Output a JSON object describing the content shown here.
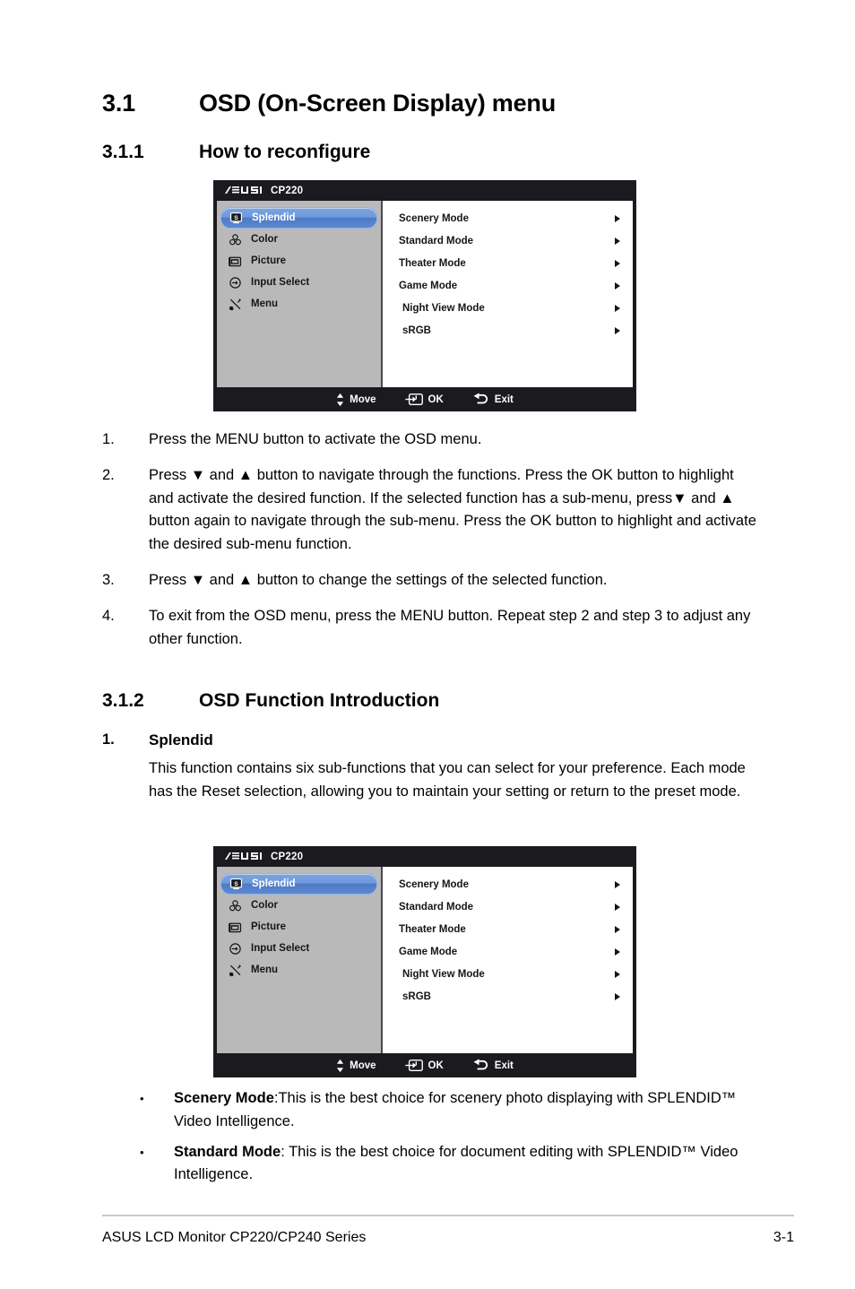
{
  "document": {
    "section_3_1": {
      "number": "3.1",
      "title": "OSD (On-Screen Display) menu"
    },
    "section_3_1_1": {
      "number": "3.1.1",
      "title": "How to reconfigure"
    },
    "section_3_1_2": {
      "number": "3.1.2",
      "title": "OSD Function Introduction"
    }
  },
  "steps": [
    {
      "marker": "1.",
      "text": "Press the MENU button to activate the OSD menu."
    },
    {
      "marker": "2.",
      "text": "Press ▼ and ▲ button to navigate through the functions. Press the OK button to highlight and activate the desired function. If the selected function has a sub-menu, press▼ and ▲ button again to navigate through the sub-menu. Press the OK button to highlight and activate the desired sub-menu function."
    },
    {
      "marker": "3.",
      "text": "Press ▼ and ▲ button to change the settings of the selected function."
    },
    {
      "marker": "4.",
      "text": "To exit from the OSD menu, press the MENU button. Repeat step 2 and step 3 to adjust any other function."
    }
  ],
  "splendid": {
    "marker": "1.",
    "title": "Splendid",
    "paragraph": "This function contains six sub-functions that you can select for your preference. Each mode has the Reset selection, allowing you to maintain your setting or return to the preset mode."
  },
  "bullets": [
    {
      "marker": "•",
      "term": "Scenery Mode",
      "separator": ":",
      "text": "This is the best choice for scenery photo displaying with SPLENDID™ Video Intelligence."
    },
    {
      "marker": "•",
      "term": "Standard Mode",
      "separator": ": ",
      "text": "This is the best choice for document editing with SPLENDID™ Video Intelligence."
    }
  ],
  "osd": {
    "brand": "ASUS",
    "model": "CP220",
    "sidebar": [
      {
        "label": "Splendid",
        "icon": "splendid-monitor-icon",
        "selected": true
      },
      {
        "label": "Color",
        "icon": "color-circles-icon",
        "selected": false
      },
      {
        "label": "Picture",
        "icon": "picture-frame-icon",
        "selected": false
      },
      {
        "label": "Input Select",
        "icon": "input-arrow-icon",
        "selected": false
      },
      {
        "label": "Menu",
        "icon": "tools-icon",
        "selected": false
      }
    ],
    "options": [
      {
        "label": "Scenery Mode",
        "indent": false,
        "arrow": "chevron-right-icon"
      },
      {
        "label": "Standard Mode",
        "indent": false,
        "arrow": "chevron-right-icon"
      },
      {
        "label": "Theater Mode",
        "indent": false,
        "arrow": "chevron-right-icon"
      },
      {
        "label": "Game Mode",
        "indent": false,
        "arrow": "chevron-right-icon"
      },
      {
        "label": "Night View Mode",
        "indent": true,
        "arrow": "chevron-right-icon"
      },
      {
        "label": "sRGB",
        "indent": true,
        "arrow": "chevron-right-icon"
      }
    ],
    "footer": [
      {
        "label": "Move",
        "icon": "up-down-arrows-icon"
      },
      {
        "label": "OK",
        "icon": "enter-key-icon"
      },
      {
        "label": "Exit",
        "icon": "back-arrow-icon"
      }
    ],
    "colors": {
      "chrome": "#1b1b1f",
      "sidebar_bg": "#b9b9b9",
      "panel_bg": "#ffffff",
      "highlight": "#5c88d2",
      "text": "#16161a",
      "chrome_text": "#ffffff"
    }
  },
  "page_footer": {
    "left": "ASUS LCD Monitor CP220/CP240 Series",
    "right": "3-1"
  }
}
